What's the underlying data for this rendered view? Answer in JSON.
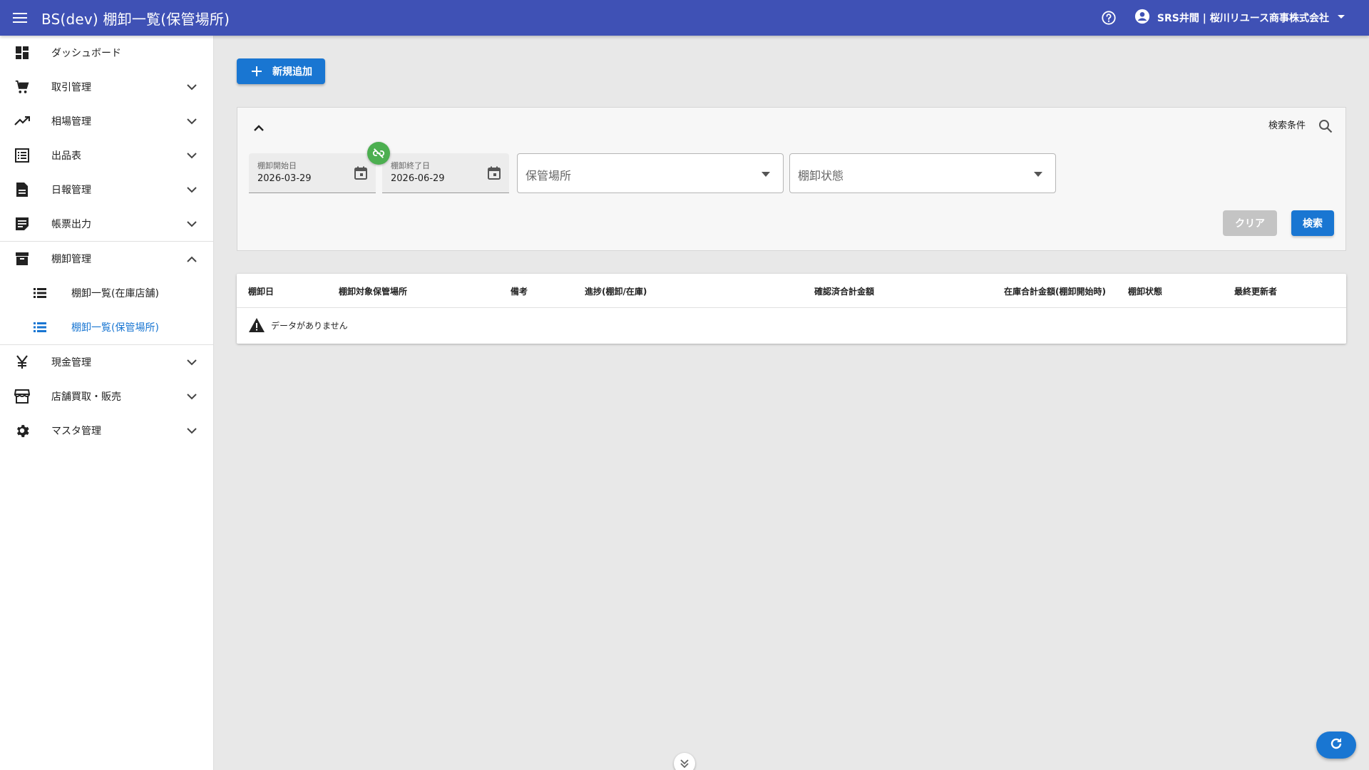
{
  "appbar": {
    "title": "BS(dev) 棚卸一覧(保管場所)",
    "user_name": "SRS井間 | 桜川リユース商事株式会社",
    "color": "#3f51b5"
  },
  "sidebar": {
    "items": [
      {
        "label": "ダッシュボード",
        "icon": "dashboard-icon"
      },
      {
        "label": "取引管理",
        "icon": "cart-icon"
      },
      {
        "label": "相場管理",
        "icon": "trending-icon"
      },
      {
        "label": "出品表",
        "icon": "list-alt-icon"
      },
      {
        "label": "日報管理",
        "icon": "document-icon"
      },
      {
        "label": "帳票出力",
        "icon": "note-icon"
      },
      {
        "label": "棚卸管理",
        "icon": "archive-icon"
      },
      {
        "label": "現金管理",
        "icon": "yen-icon"
      },
      {
        "label": "店舗買取・販売",
        "icon": "store-icon"
      },
      {
        "label": "マスタ管理",
        "icon": "gear-icon"
      }
    ],
    "sub_items": [
      {
        "label": "棚卸一覧(在庫店舗)"
      },
      {
        "label": "棚卸一覧(保管場所)"
      }
    ],
    "active_color": "#1976d2"
  },
  "toolbar": {
    "add_label": "新規追加"
  },
  "search": {
    "title": "検索条件",
    "start_date": {
      "label": "棚卸開始日",
      "value": "2026-03-29"
    },
    "end_date": {
      "label": "棚卸終了日",
      "value": "2026-06-29"
    },
    "location_placeholder": "保管場所",
    "status_placeholder": "棚卸状態",
    "clear_label": "クリア",
    "search_label": "検索"
  },
  "table": {
    "columns": [
      "棚卸日",
      "棚卸対象保管場所",
      "備考",
      "進捗(棚卸/在庫)",
      "確認済合計金額",
      "在庫合計金額(棚卸開始時)",
      "棚卸状態",
      "最終更新者"
    ],
    "empty_message": "データがありません"
  }
}
